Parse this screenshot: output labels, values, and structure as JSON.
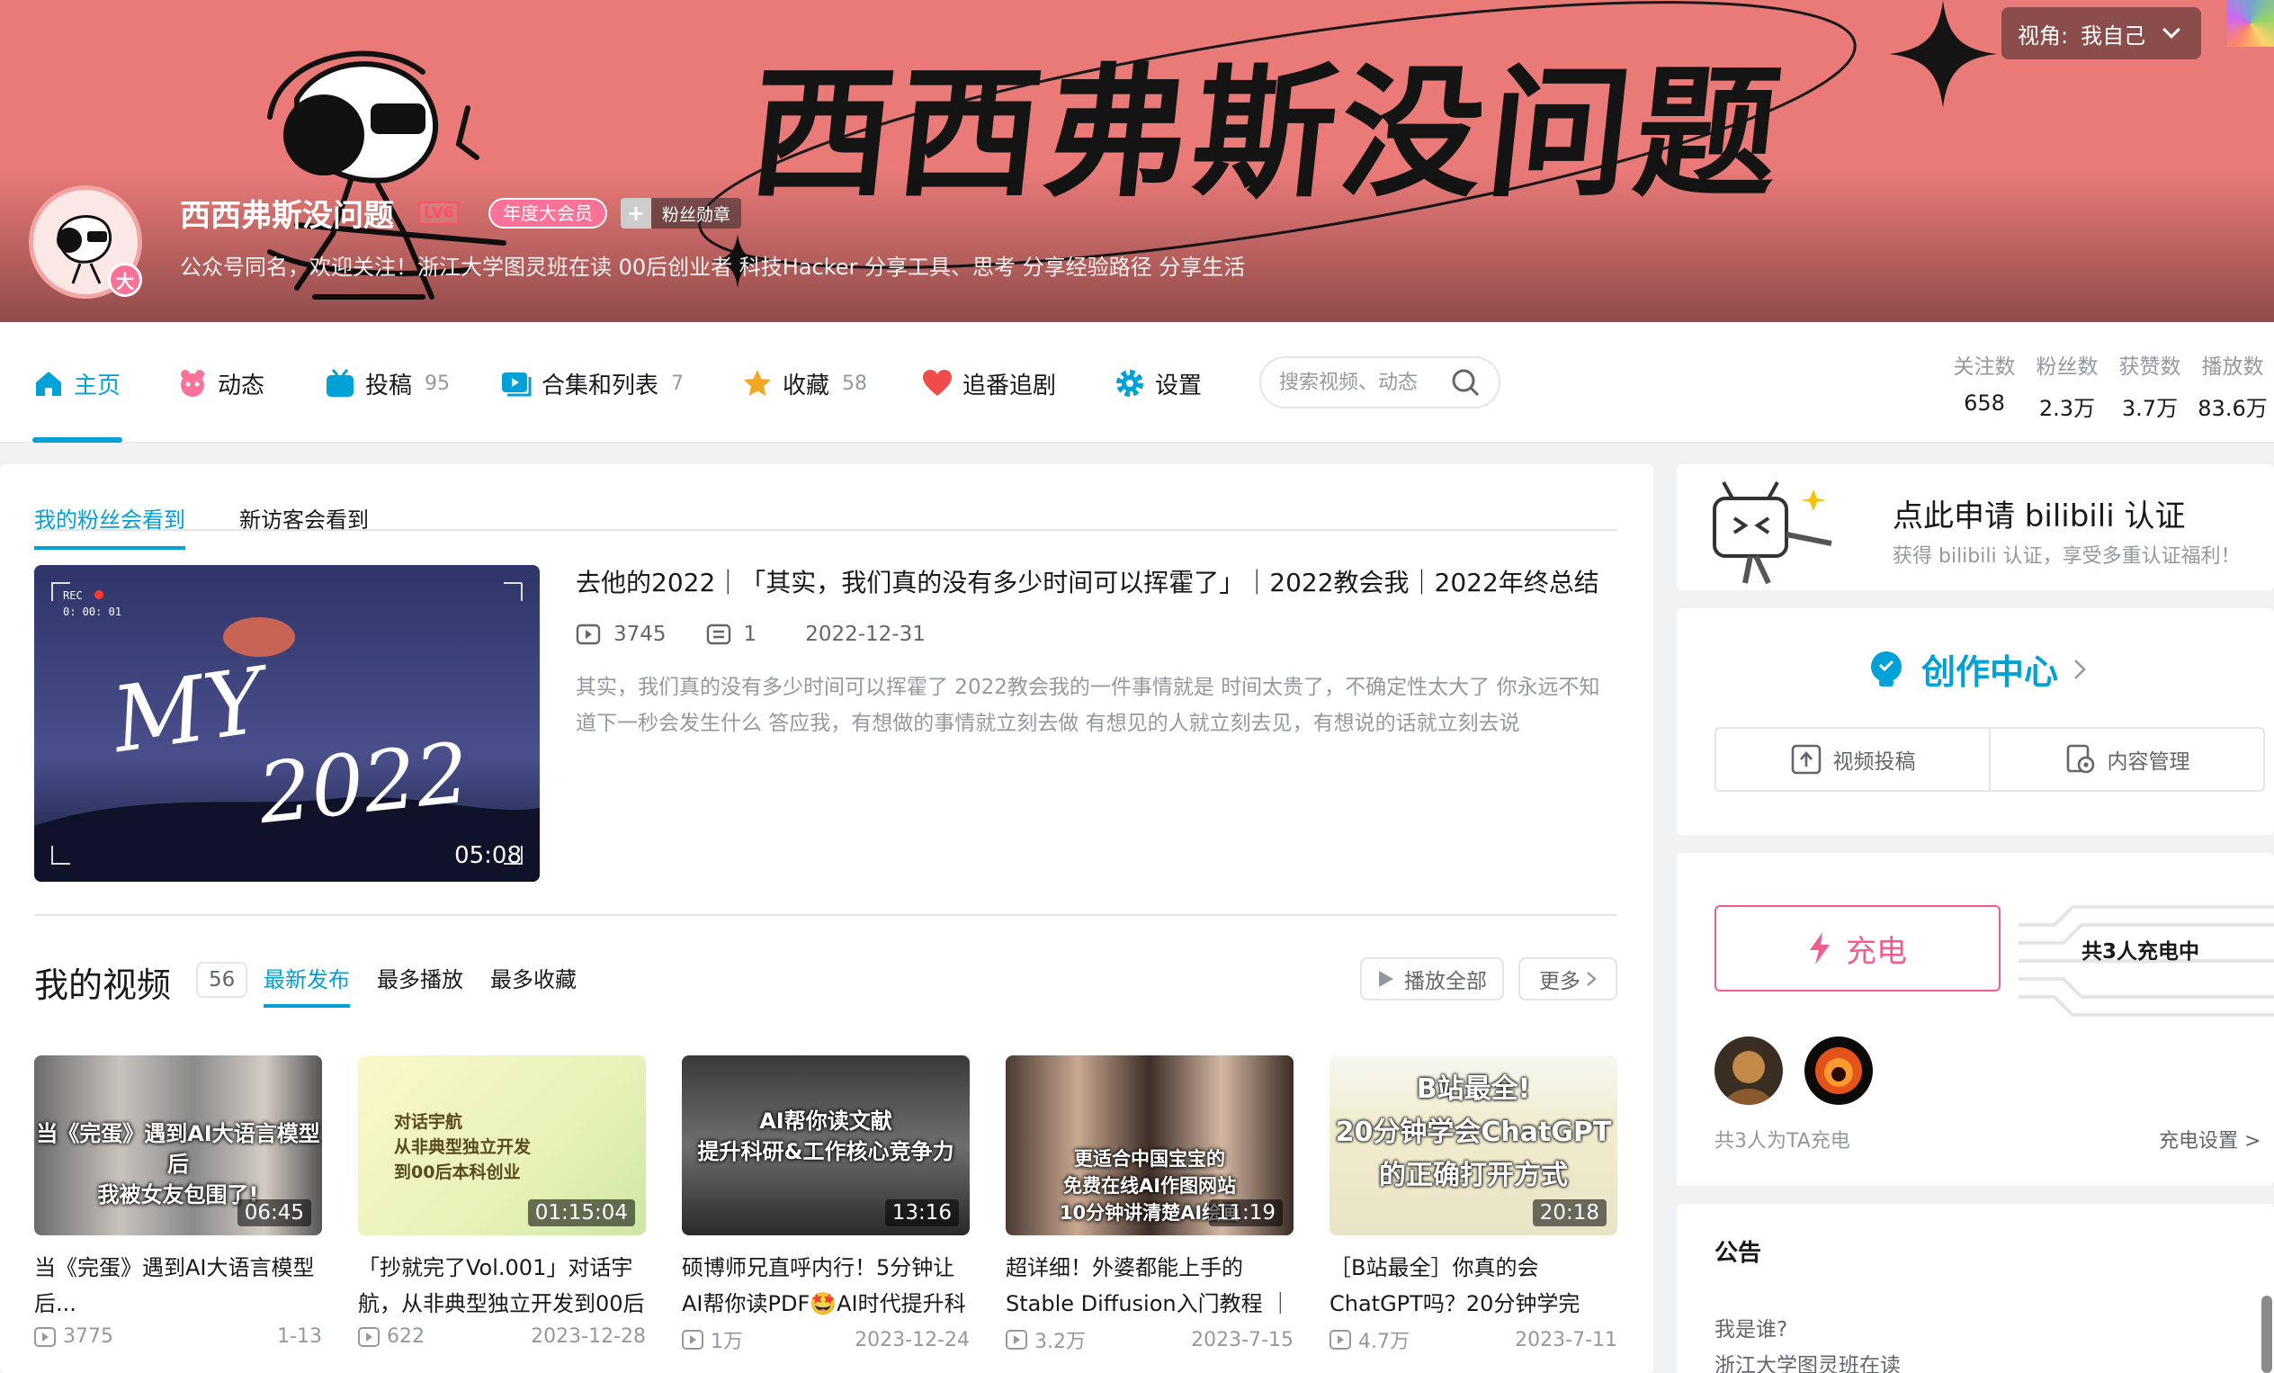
{
  "banner": {
    "title_art": "西西弗斯没问题",
    "view_as_label": "视角:",
    "view_as_value": "我自己"
  },
  "profile": {
    "name": "西西弗斯没问题",
    "level": "LV6",
    "vip_badge": "年度大会员",
    "medal_label": "粉丝勋章",
    "avatar_badge": "大",
    "sign": "公众号同名，欢迎关注！浙江大学图灵班在读 00后创业者 科技Hacker 分享工具、思考 分享经验路径 分享生活"
  },
  "nav": {
    "items": [
      {
        "label": "主页",
        "count": ""
      },
      {
        "label": "动态",
        "count": ""
      },
      {
        "label": "投稿",
        "count": "95"
      },
      {
        "label": "合集和列表",
        "count": "7"
      },
      {
        "label": "收藏",
        "count": "58"
      },
      {
        "label": "追番追剧",
        "count": ""
      },
      {
        "label": "设置",
        "count": ""
      }
    ],
    "search_placeholder": "搜索视频、动态",
    "stats": [
      {
        "label": "关注数",
        "value": "658"
      },
      {
        "label": "粉丝数",
        "value": "2.3万"
      },
      {
        "label": "获赞数",
        "value": "3.7万"
      },
      {
        "label": "播放数",
        "value": "83.6万"
      }
    ]
  },
  "featured": {
    "tabs": [
      "我的粉丝会看到",
      "新访客会看到"
    ],
    "thumb_text": "MY 2022",
    "thumb_rec": "REC",
    "thumb_time": "0: 00: 01",
    "duration": "05:08",
    "title": "去他的2022｜「其实，我们真的没有多少时间可以挥霍了」｜2022教会我｜2022年终总结",
    "plays": "3745",
    "comments": "1",
    "date": "2022-12-31",
    "desc": "其实，我们真的没有多少时间可以挥霍了 2022教会我的一件事情就是 时间太贵了，不确定性太大了 你永远不知道下一秒会发生什么 答应我，有想做的事情就立刻去做 有想见的人就立刻去见，有想说的话就立刻去说"
  },
  "my_videos": {
    "title": "我的视频",
    "count": "56",
    "tabs": [
      "最新发布",
      "最多播放",
      "最多收藏"
    ],
    "play_all": "播放全部",
    "more": "更多",
    "videos": [
      {
        "caption": "当《完蛋》遇到AI大语言模型后\n我被女友包围了!",
        "duration": "06:45",
        "title": "当《完蛋》遇到AI大语言模型后...",
        "plays": "3775",
        "date": "1-13"
      },
      {
        "caption": "对话宇航\n从非典型独立开发\n到00后本科创业",
        "duration": "01:15:04",
        "title": "「抄就完了Vol.001」对话宇航，从非典型独立开发到00后",
        "plays": "622",
        "date": "2023-12-28"
      },
      {
        "caption": "AI帮你读文献\n提升科研&工作核心竞争力",
        "duration": "13:16",
        "title": "硕博师兄直呼内行！5分钟让AI帮你读PDF🤩AI时代提升科",
        "plays": "1万",
        "date": "2023-12-24"
      },
      {
        "caption": "更适合中国宝宝的\n免费在线AI作图网站\n10分钟讲清楚AI绘画",
        "duration": "11:19",
        "title": "超详细！外婆都能上手的Stable Diffusion入门教程 ｜",
        "plays": "3.2万",
        "date": "2023-7-15"
      },
      {
        "caption": "B站最全!\n20分钟学会ChatGPT\n的正确打开方式",
        "duration": "20:18",
        "title": "［B站最全］你真的会ChatGPT吗？20分钟学完",
        "plays": "4.7万",
        "date": "2023-7-11"
      }
    ]
  },
  "auth": {
    "title": "点此申请 bilibili 认证",
    "sub": "获得 bilibili 认证，享受多重认证福利！"
  },
  "creator": {
    "title": "创作中心",
    "upload": "视频投稿",
    "manage": "内容管理"
  },
  "charge": {
    "button": "充电",
    "count_text": "共3人充电中",
    "who_text": "共3人为TA充电",
    "settings": "充电设置 >"
  },
  "notice": {
    "title": "公告",
    "line1": "我是谁?",
    "line2": "浙江大学图灵班在读"
  },
  "colors": {
    "accent": "#00a1d6",
    "banner": "#e97a78",
    "pink": "#fb7299",
    "charge": "#f25d8e"
  }
}
